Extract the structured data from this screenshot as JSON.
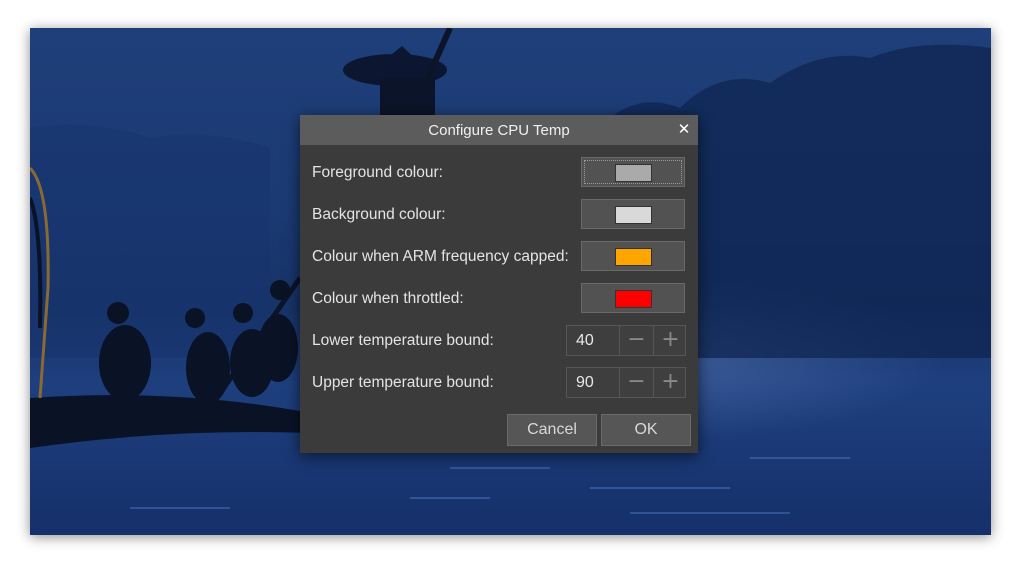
{
  "dialog": {
    "title": "Configure CPU Temp",
    "close_glyph": "✕"
  },
  "rows": {
    "foreground": {
      "label": "Foreground colour:",
      "color": "#aaaaaa"
    },
    "background": {
      "label": "Background colour:",
      "color": "#d9d9d9"
    },
    "arm_capped": {
      "label": "Colour when ARM frequency capped:",
      "color": "#ffa500"
    },
    "throttled": {
      "label": "Colour when throttled:",
      "color": "#ff0000"
    },
    "lower_bound": {
      "label": "Lower temperature bound:",
      "value": "40"
    },
    "upper_bound": {
      "label": "Upper temperature bound:",
      "value": "90"
    }
  },
  "spin": {
    "minus_glyph": "−",
    "plus_glyph": "+"
  },
  "buttons": {
    "cancel": "Cancel",
    "ok": "OK"
  },
  "theme": {
    "dialog_bg": "#3b3b3b",
    "titlebar_bg": "#5c5c5c",
    "wallpaper_blue": "#1b3a74"
  }
}
